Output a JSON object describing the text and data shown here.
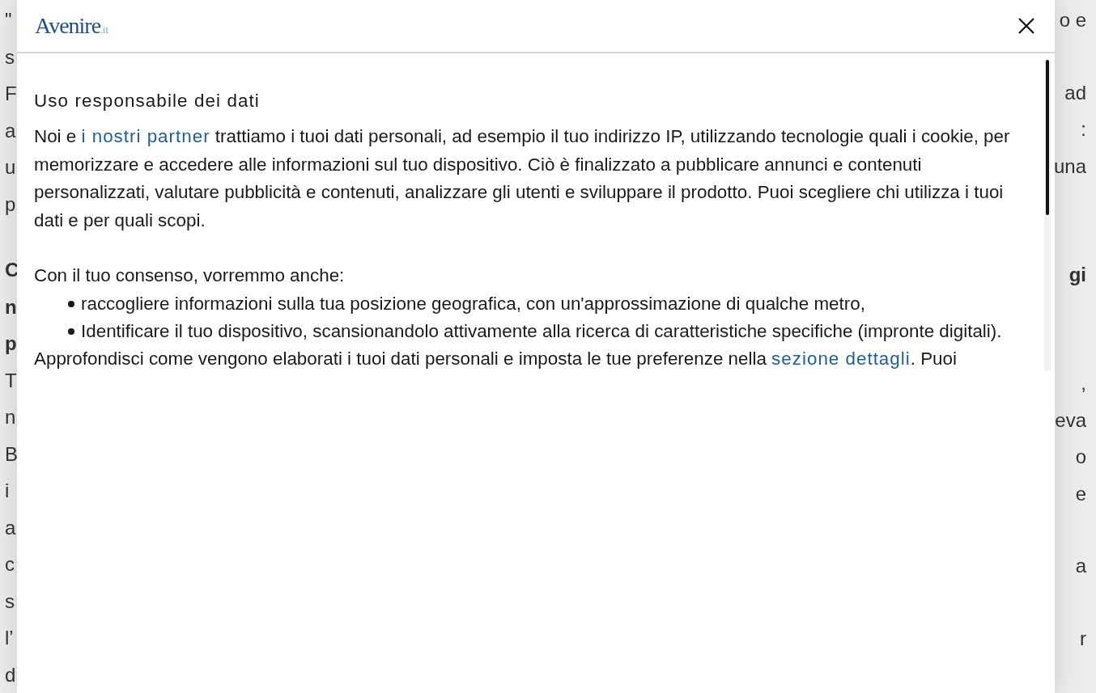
{
  "background_page": {
    "lines": [
      {
        "left": "\"",
        "right": "o e",
        "bold": false
      },
      {
        "left": "s",
        "bold": false
      },
      {
        "left": "F",
        "right": "ad",
        "bold": false
      },
      {
        "left": "a",
        "right": ":",
        "bold": false
      },
      {
        "left": "u",
        "right": "una",
        "bold": false
      },
      {
        "left": "p",
        "bold": false
      },
      {
        "left": "C",
        "right": "gi",
        "bold": true
      },
      {
        "left": "n",
        "bold": true
      },
      {
        "left": "p",
        "bold": true
      },
      {
        "left": "T",
        "right": ",",
        "bold": false
      },
      {
        "left": "n",
        "right": "eva",
        "bold": false
      },
      {
        "left": "B",
        "right": "o",
        "bold": false
      },
      {
        "left": "i",
        "right": "e",
        "bold": false
      },
      {
        "left": "a",
        "bold": false
      },
      {
        "left": "c",
        "right": "a",
        "bold": false
      },
      {
        "left": "s",
        "bold": false
      },
      {
        "left": "l’",
        "right": "r",
        "bold": false
      },
      {
        "left": "d",
        "bold": false
      }
    ]
  },
  "dialog": {
    "logo": {
      "text": "Avenire",
      "suffix": ".it"
    },
    "title": "Uso responsabile dei dati",
    "intro": [
      {
        "text": "Noi e "
      },
      {
        "text": "i nostri partner",
        "link": true
      },
      {
        "text": " trattiamo i tuoi dati personali, ad esempio il tuo indirizzo IP, utilizzando tecnologie quali i cookie, per memorizzare e accedere alle informazioni sul tuo dispositivo. Ciò è finalizzato a pubblicare annunci e contenuti personalizzati, valutare pubblicità e contenuti, analizzare gli utenti e sviluppare il prodotto. Puoi scegliere chi utilizza i tuoi dati e per quali scopi."
      }
    ],
    "consent_heading": "Con il tuo consenso, vorremmo anche:",
    "consent_items": [
      "raccogliere informazioni sulla tua posizione geografica, con un'approssimazione di qualche metro,",
      "Identificare il tuo dispositivo, scansionandolo attivamente alla ricerca di caratteristiche specifiche (impronte digitali)."
    ],
    "details": [
      {
        "text": "Approfondisci come vengono elaborati i tuoi dati personali e imposta le tue preferenze nella "
      },
      {
        "text": "sezione dettagli",
        "link": true
      },
      {
        "text": ". Puoi"
      }
    ]
  }
}
